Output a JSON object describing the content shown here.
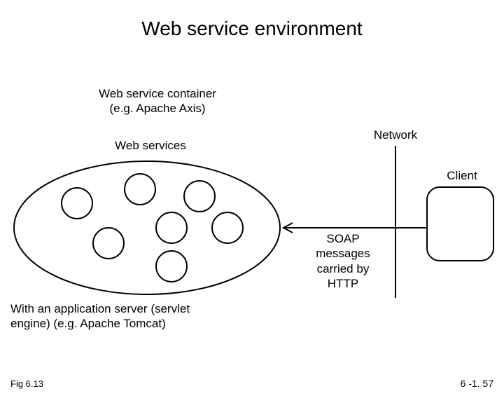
{
  "title": "Web service environment",
  "labels": {
    "container": "Web service container\n(e.g. Apache Axis)",
    "services": "Web services",
    "network": "Network",
    "client": "Client",
    "soap": "SOAP\nmessages\ncarried by\nHTTP",
    "appserver": "With an application server (servlet\nengine) (e.g. Apache Tomcat)"
  },
  "footer": {
    "fig": "Fig 6.13",
    "page": "6 -1. 57"
  }
}
